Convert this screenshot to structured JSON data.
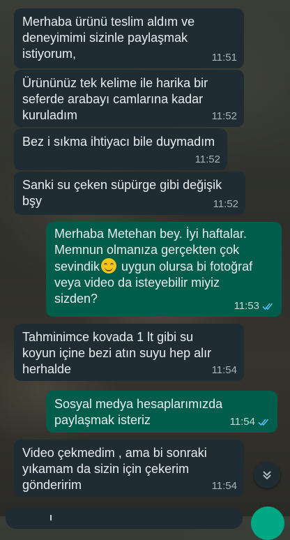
{
  "messages": [
    {
      "direction": "incoming",
      "text": "Merhaba ürünü teslim aldım ve\ndeneyimimi sizinle paylaşmak\nistiyorum,",
      "time": "11:51"
    },
    {
      "direction": "incoming",
      "text": "Ürününüz tek kelime ile harika bir\nseferde arabayı camlarına kadar\nkuruladım",
      "time": "11:52"
    },
    {
      "direction": "incoming",
      "text": "Bez i sıkma ihtiyacı bile duymadım",
      "time": "11:52"
    },
    {
      "direction": "incoming",
      "text": "Sanki su çeken süpürge gibi değişik\nbşy",
      "time": "11:52"
    },
    {
      "direction": "outgoing",
      "text_before_emoji": "Merhaba Metehan bey. İyi haftalar.\nMemnun olmanıza gerçekten çok\nsevindik",
      "emoji": "smiling-face-emoji",
      "text_after_emoji": " uygun olursa bi fotoğraf\nveya video da isteyebilir miyiz\nsizden?",
      "time": "11:53",
      "status": "read"
    },
    {
      "direction": "incoming",
      "text": "Tahminimce kovada 1 lt gibi su\nkoyun içine bezi atın suyu hep alır\nherhalde",
      "time": "11:54"
    },
    {
      "direction": "outgoing",
      "text": "Sosyal medya hesaplarımızda\npaylaşmak isteriz",
      "time": "11:54",
      "status": "read"
    },
    {
      "direction": "incoming",
      "text": "Video çekmedim , ama bi sonraki\nyıkamam da sizin için çekerim\ngönderirim",
      "time": "11:54"
    }
  ],
  "colors": {
    "incoming_bubble": "#1f2c33",
    "outgoing_bubble": "#005c4b",
    "read_ticks": "#53bdeb",
    "send_button": "#00a884"
  },
  "icons": {
    "scroll_down": "chevron-double-down-icon",
    "read_receipt": "double-check-icon"
  }
}
